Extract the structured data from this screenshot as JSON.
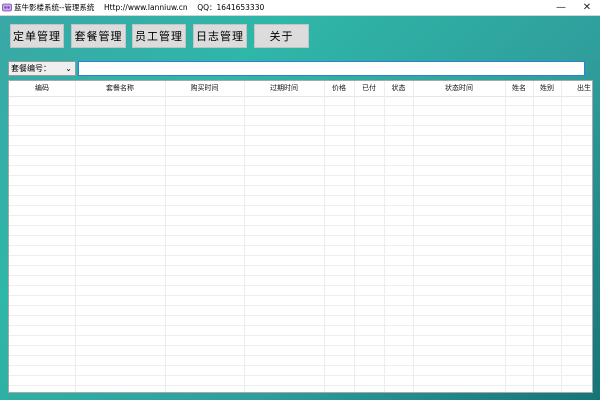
{
  "window": {
    "title": "蓝牛影楼系统--管理系统",
    "url_text": "Http://www.lanniuw.cn",
    "qq_text": "QQ：1641653330",
    "minimize_icon": "minimize-icon",
    "close_icon": "close-icon"
  },
  "toolbar": {
    "buttons": [
      "定单管理",
      "套餐管理",
      "员工管理",
      "日志管理",
      "关于"
    ]
  },
  "filter": {
    "selected": "套餐编号：",
    "search_value": ""
  },
  "table": {
    "columns": [
      "编码",
      "套餐名称",
      "购买时间",
      "过期时间",
      "价格",
      "已付",
      "状态",
      "状态时间",
      "姓名",
      "姓别",
      "出生"
    ]
  },
  "colors": {
    "accent": "#2fb7a8",
    "input_focus": "#2e7fd8"
  }
}
